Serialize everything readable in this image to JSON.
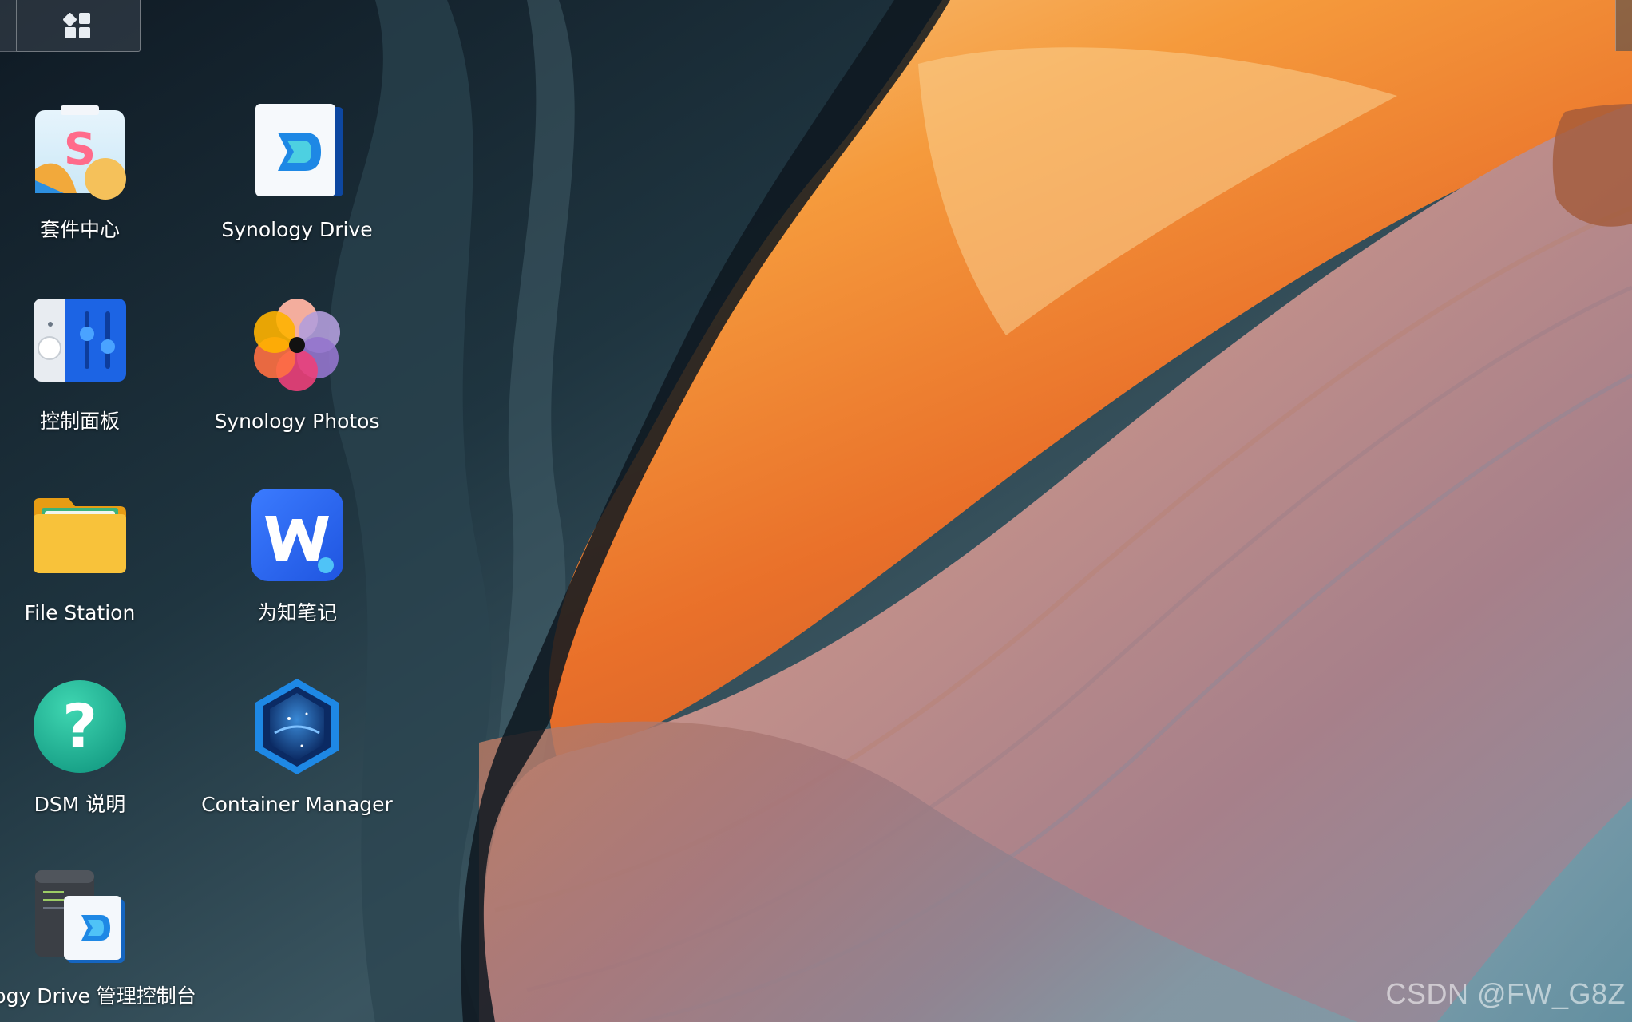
{
  "taskbar": {
    "main_menu_icon": "grid-apps-icon"
  },
  "shortcuts": [
    {
      "label": "套件中心",
      "icon": "package-center-icon"
    },
    {
      "label": "Synology Drive",
      "icon": "synology-drive-icon"
    },
    {
      "label": "控制面板",
      "icon": "control-panel-icon"
    },
    {
      "label": "Synology Photos",
      "icon": "synology-photos-icon"
    },
    {
      "label": "File Station",
      "icon": "file-station-icon"
    },
    {
      "label": "为知笔记",
      "icon": "wiznote-icon"
    },
    {
      "label": "DSM 说明",
      "icon": "dsm-help-icon"
    },
    {
      "label": "Container Manager",
      "icon": "container-manager-icon"
    },
    {
      "label": "nology Drive 管理控制台",
      "icon": "synology-drive-admin-icon"
    }
  ],
  "watermark": "CSDN @FW_G8Z",
  "colors": {
    "drive_blue": "#1e88e5",
    "wiz_blue": "#2f6bf5",
    "help_teal": "#1fb99a",
    "folder_yellow": "#f6b71e",
    "container_blue": "#1565c0"
  }
}
